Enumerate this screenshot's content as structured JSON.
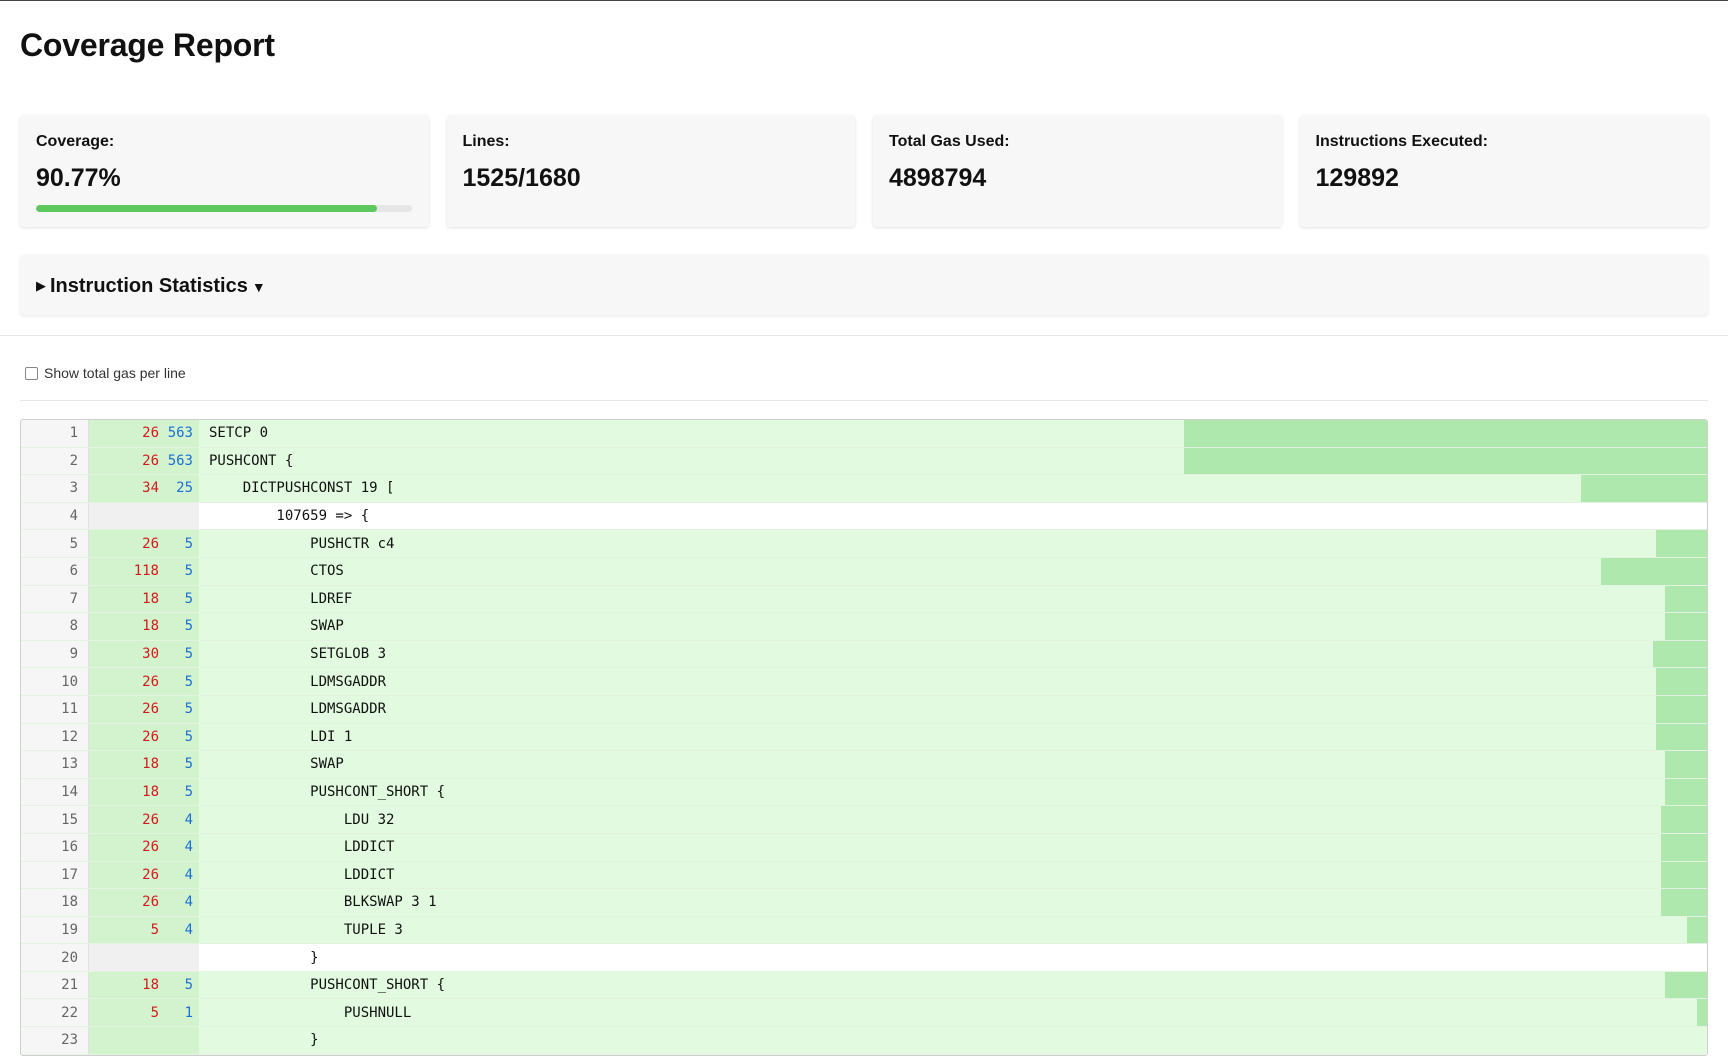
{
  "title": "Coverage Report",
  "stats": {
    "coverage_label": "Coverage:",
    "coverage_value": "90.77%",
    "coverage_fraction": 0.9077,
    "lines_label": "Lines:",
    "lines_value": "1525/1680",
    "gas_label": "Total Gas Used:",
    "gas_value": "4898794",
    "instr_label": "Instructions Executed:",
    "instr_value": "129892"
  },
  "instruction_stats": {
    "label": "Instruction Statistics",
    "expand_icon": "triangle-right-icon",
    "caret_icon": "caret-down-icon"
  },
  "options": {
    "show_total_gas_label": "Show total gas per line",
    "show_total_gas_checked": false
  },
  "colors": {
    "covered_bg": "#e2fbe0",
    "heat_bar": "#afe8ac",
    "gas_text": "#d41a1a",
    "hits_text": "#1a6fd4",
    "progress": "#5cc85e"
  },
  "code_lines": [
    {
      "n": "1",
      "gas": "26",
      "hits": "563",
      "code": "SETCP 0",
      "covered": true,
      "heat": 0.31
    },
    {
      "n": "2",
      "gas": "26",
      "hits": "563",
      "code": "PUSHCONT {",
      "covered": true,
      "heat": 0.31
    },
    {
      "n": "3",
      "gas": "34",
      "hits": "25",
      "code": "    DICTPUSHCONST 19 [",
      "covered": true,
      "heat": 0.075
    },
    {
      "n": "4",
      "gas": "",
      "hits": "",
      "code": "        107659 => {",
      "covered": false,
      "heat": 0
    },
    {
      "n": "5",
      "gas": "26",
      "hits": "5",
      "code": "            PUSHCTR c4",
      "covered": true,
      "heat": 0.03
    },
    {
      "n": "6",
      "gas": "118",
      "hits": "5",
      "code": "            CTOS",
      "covered": true,
      "heat": 0.063
    },
    {
      "n": "7",
      "gas": "18",
      "hits": "5",
      "code": "            LDREF",
      "covered": true,
      "heat": 0.025
    },
    {
      "n": "8",
      "gas": "18",
      "hits": "5",
      "code": "            SWAP",
      "covered": true,
      "heat": 0.025
    },
    {
      "n": "9",
      "gas": "30",
      "hits": "5",
      "code": "            SETGLOB 3",
      "covered": true,
      "heat": 0.032
    },
    {
      "n": "10",
      "gas": "26",
      "hits": "5",
      "code": "            LDMSGADDR",
      "covered": true,
      "heat": 0.03
    },
    {
      "n": "11",
      "gas": "26",
      "hits": "5",
      "code": "            LDMSGADDR",
      "covered": true,
      "heat": 0.03
    },
    {
      "n": "12",
      "gas": "26",
      "hits": "5",
      "code": "            LDI 1",
      "covered": true,
      "heat": 0.03
    },
    {
      "n": "13",
      "gas": "18",
      "hits": "5",
      "code": "            SWAP",
      "covered": true,
      "heat": 0.025
    },
    {
      "n": "14",
      "gas": "18",
      "hits": "5",
      "code": "            PUSHCONT_SHORT {",
      "covered": true,
      "heat": 0.025
    },
    {
      "n": "15",
      "gas": "26",
      "hits": "4",
      "code": "                LDU 32",
      "covered": true,
      "heat": 0.027
    },
    {
      "n": "16",
      "gas": "26",
      "hits": "4",
      "code": "                LDDICT",
      "covered": true,
      "heat": 0.027
    },
    {
      "n": "17",
      "gas": "26",
      "hits": "4",
      "code": "                LDDICT",
      "covered": true,
      "heat": 0.027
    },
    {
      "n": "18",
      "gas": "26",
      "hits": "4",
      "code": "                BLKSWAP 3 1",
      "covered": true,
      "heat": 0.027
    },
    {
      "n": "19",
      "gas": "5",
      "hits": "4",
      "code": "                TUPLE 3",
      "covered": true,
      "heat": 0.012
    },
    {
      "n": "20",
      "gas": "",
      "hits": "",
      "code": "            }",
      "covered": false,
      "heat": 0
    },
    {
      "n": "21",
      "gas": "18",
      "hits": "5",
      "code": "            PUSHCONT_SHORT {",
      "covered": true,
      "heat": 0.025
    },
    {
      "n": "22",
      "gas": "5",
      "hits": "1",
      "code": "                PUSHNULL",
      "covered": true,
      "heat": 0.006
    },
    {
      "n": "23",
      "gas": "",
      "hits": "",
      "code": "            }",
      "covered": true,
      "heat": 0
    }
  ]
}
